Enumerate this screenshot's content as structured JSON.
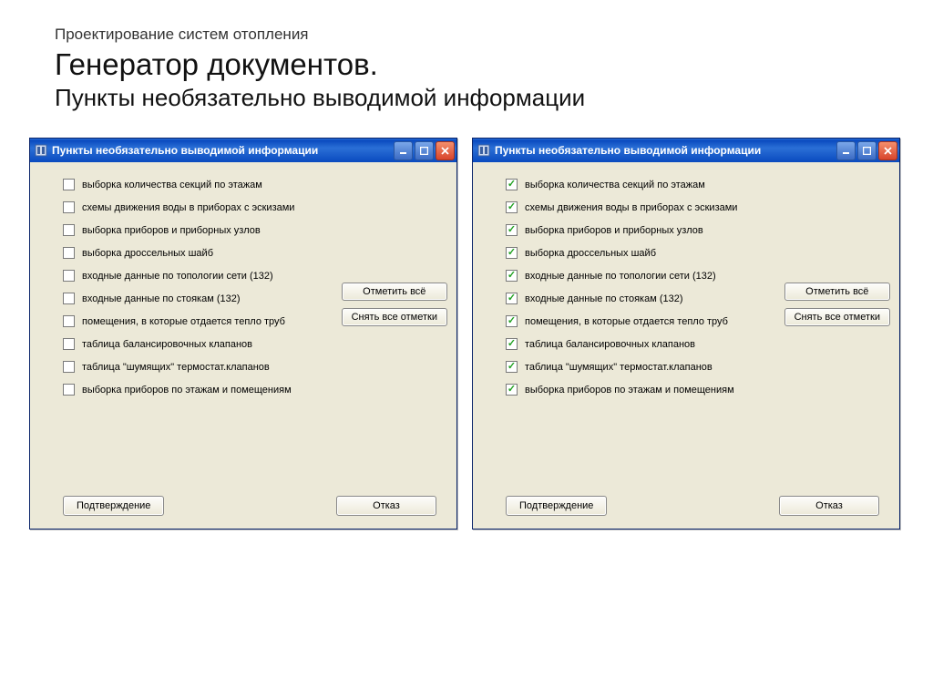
{
  "header": {
    "subtitle": "Проектирование систем отопления",
    "title_main": "Генератор документов.",
    "title_sub": "Пункты необязательно выводимой информации"
  },
  "window": {
    "title": "Пункты необязательно выводимой информации",
    "items": [
      "выборка количества секций по этажам",
      "схемы движения воды в приборах с эскизами",
      "выборка приборов и приборных узлов",
      "выборка дроссельных шайб",
      "входные данные по топологии сети (132)",
      "входные данные по стоякам (132)",
      "помещения, в которые отдается тепло труб",
      "таблица балансировочных клапанов",
      "таблица \"шумящих\" термостат.клапанов",
      "выборка приборов по этажам и помещениям"
    ],
    "buttons": {
      "check_all": "Отметить всё",
      "uncheck_all": "Снять все отметки",
      "confirm": "Подтверждение",
      "cancel": "Отказ"
    }
  },
  "windows": [
    {
      "all_checked": false
    },
    {
      "all_checked": true
    }
  ]
}
